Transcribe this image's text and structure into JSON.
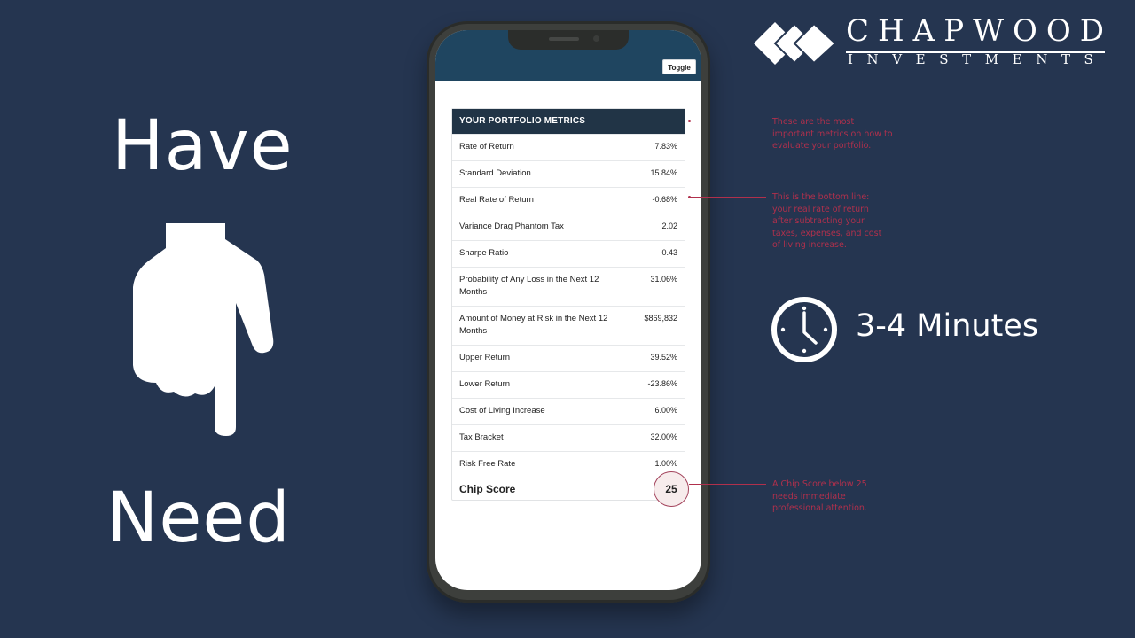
{
  "slide": {
    "top_word": "Have",
    "bottom_word": "Need",
    "hand_icon": "pointing-down-hand",
    "duration": "3-4 Minutes",
    "clock_icon": "clock"
  },
  "logo": {
    "brand": "CHAPWOOD",
    "subtitle": "INVESTMENTS",
    "mark_icon": "three-diamonds"
  },
  "app": {
    "toggle_label": "Toggle",
    "metrics": {
      "title": "YOUR PORTFOLIO METRICS",
      "rows": [
        {
          "label": "Rate of Return",
          "value": "7.83%"
        },
        {
          "label": "Standard Deviation",
          "value": "15.84%"
        },
        {
          "label": "Real Rate of Return",
          "value": "-0.68%"
        },
        {
          "label": "Variance Drag Phantom Tax",
          "value": "2.02"
        },
        {
          "label": "Sharpe Ratio",
          "value": "0.43"
        },
        {
          "label": "Probability of Any Loss in the Next 12 Months",
          "value": "31.06%"
        },
        {
          "label": "Amount of Money at Risk in the Next 12 Months",
          "value": "$869,832"
        },
        {
          "label": "Upper Return",
          "value": "39.52%"
        },
        {
          "label": "Lower Return",
          "value": "-23.86%"
        },
        {
          "label": "Cost of Living Increase",
          "value": "6.00%"
        },
        {
          "label": "Tax Bracket",
          "value": "32.00%"
        },
        {
          "label": "Risk Free Rate",
          "value": "1.00%"
        }
      ],
      "chip_score": {
        "label": "Chip Score",
        "value": "25"
      }
    }
  },
  "annotations": [
    {
      "text": "These are the most important metrics on how to evaluate your portfolio."
    },
    {
      "text": "This is the bottom line: your real rate of return after subtracting your taxes, expenses, and cost of living increase."
    },
    {
      "text": "A Chip Score below 25 needs immediate professional attention."
    }
  ],
  "colors": {
    "background": "#253550",
    "app_header": "#1f4560",
    "table_header": "#213446",
    "annotation": "#b0304c"
  }
}
